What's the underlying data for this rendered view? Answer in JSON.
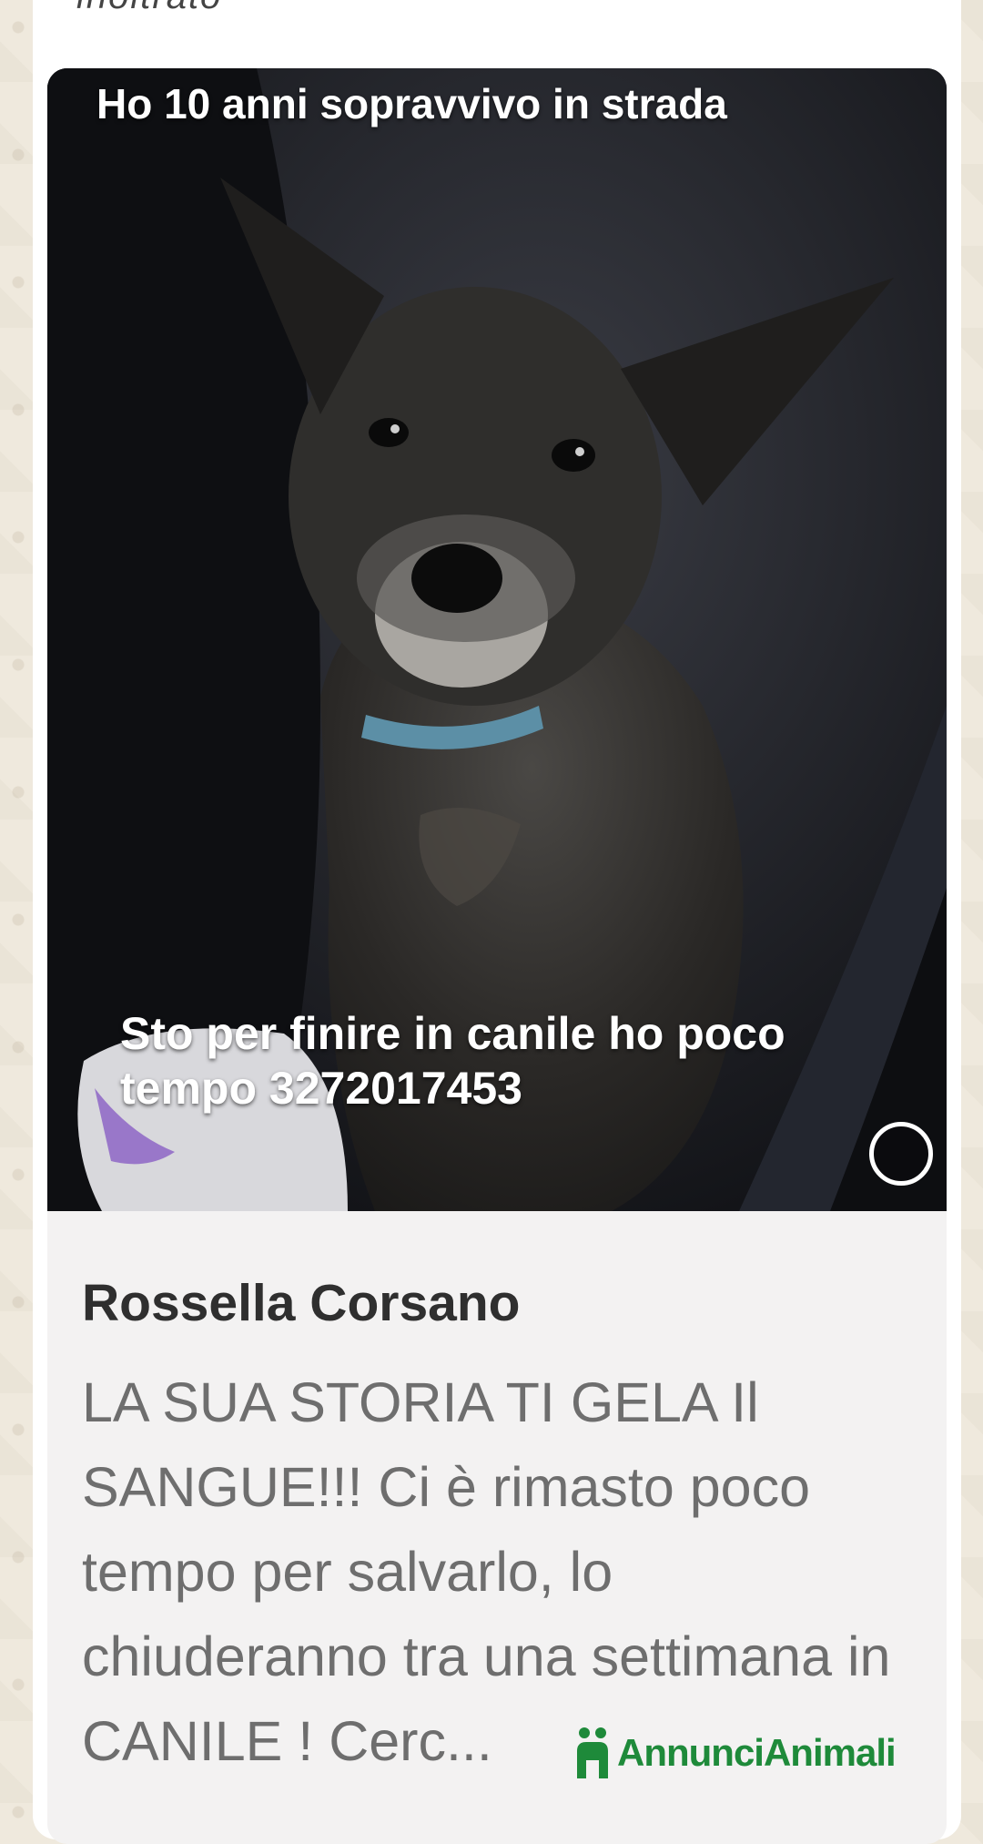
{
  "header": {
    "fragment": "inoltrato"
  },
  "post": {
    "overlay_top": "Ho 10 anni sopravvivo in strada",
    "overlay_bottom": "Sto per finire in canile ho poco tempo 3272017453",
    "author": "Rossella Corsano",
    "description": "LA SUA STORIA TI GELA Il SANGUE!!! Ci è rimasto poco tempo per salvarlo, lo chiuderanno tra una settimana in CANILE ! Cerc..."
  },
  "watermark": {
    "brand": "AnnunciAnimali",
    "icon": "paw-logo-icon",
    "color": "#1e8a3a"
  },
  "icons": {
    "video_indicator": "play-circle-icon"
  }
}
